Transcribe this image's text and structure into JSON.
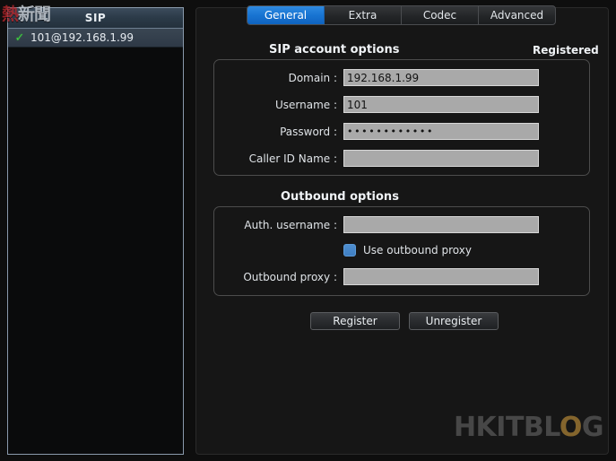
{
  "window": {
    "bg_color": "#0e0e0e"
  },
  "watermarks": {
    "cn_logo_red": "熱",
    "cn_logo_rest": "新聞",
    "hk_prefix": "HKITBL",
    "hk_o": "O",
    "hk_suffix": "G"
  },
  "sidebar": {
    "header_title": "SIP",
    "accounts": [
      {
        "check_icon": "✓",
        "label": "101@192.168.1.99",
        "selected": true
      }
    ]
  },
  "tabs": [
    {
      "label": "General",
      "active": true
    },
    {
      "label": "Extra",
      "active": false
    },
    {
      "label": "Codec",
      "active": false
    },
    {
      "label": "Advanced",
      "active": false
    }
  ],
  "main": {
    "sip_section_title": "SIP account options",
    "registration_status": "Registered",
    "sip_fields": [
      {
        "label": "Domain :",
        "value": "192.168.1.99",
        "placeholder": "",
        "type": "text"
      },
      {
        "label": "Username :",
        "value": "101",
        "placeholder": "",
        "type": "text"
      },
      {
        "label": "Password :",
        "value": "••••••••••••",
        "placeholder": "",
        "type": "password"
      },
      {
        "label": "Caller ID Name :",
        "value": "",
        "placeholder": "",
        "type": "text"
      }
    ],
    "outbound_section_title": "Outbound options",
    "outbound_fields": [
      {
        "label": "Auth. username :",
        "value": "",
        "placeholder": "",
        "type": "text"
      },
      {
        "label": "Outbound proxy :",
        "value": "",
        "placeholder": "",
        "type": "text"
      }
    ],
    "use_outbound_proxy": {
      "label": "Use outbound proxy",
      "checked": true
    },
    "buttons": {
      "register": "Register",
      "unregister": "Unregister"
    }
  },
  "colors": {
    "accent_blue": "#1874d2",
    "checkbox_blue": "#4080c4",
    "check_green": "#3fd13f",
    "input_bg": "#a9a9a9",
    "panel_bg": "#161616",
    "sidebar_border": "#8a9aac",
    "watermark_orange": "#8a6a2f"
  }
}
